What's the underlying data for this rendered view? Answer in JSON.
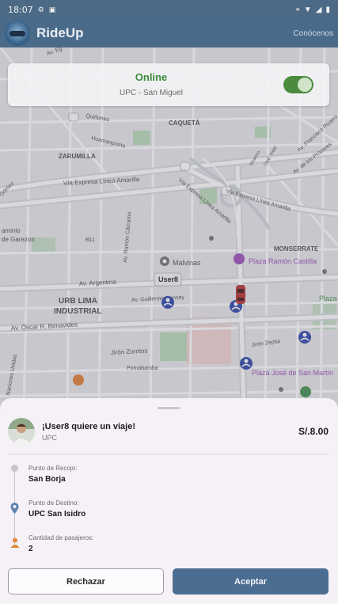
{
  "status_bar": {
    "time": "18:07"
  },
  "app_bar": {
    "title": "RideUp",
    "action": "Conócenos"
  },
  "map": {
    "labels": {
      "caqueta": "CAQUETÁ",
      "zarumilla": "ZARUMILLA",
      "via_expresa_1": "Vía Expresa Línea Amarilla",
      "via_expresa_2": "Vía Expresa Línea Amarilla",
      "via_expresa_3": "Vía Expresa Línea Amarilla",
      "huamanpoma": "Huamanpoma",
      "quilones": "Quiñones",
      "monserrate": "MONSERRATE",
      "plaza_castilla": "Plaza Ramón Castilla",
      "malvinas": "Malvinas",
      "user_tag": "User8",
      "av_argentina": "Av. Argentina",
      "urb_lima_1": "URB LIMA",
      "urb_lima_2": "INDUSTRIAL",
      "av_gullermo": "Av. Guillermo Dansey",
      "av_oscar": "Av. Óscar R. Benavides",
      "jiron_zorritos": "Jirón Zorritos",
      "jiron_zepita": "Jirón Zepita",
      "plaza_san_martin": "Plaza José de San Martín",
      "pomabamba": "Pomabamba",
      "av_ramon": "Av. Ramón Cárcamo",
      "av_francisco": "Av. Francisco Pizarro",
      "de_los_proceres": "Av. de los Próceres",
      "plaza_label": "Plaza",
      "b11": "B11",
      "gamez": "Gómez",
      "naciones": "Naciones Unidas",
      "garezon": "de Garezon",
      "aminio": "aminio",
      "av_eggg": "Av. Eg",
      "vivanco": "Vivanco",
      "gral_vidal": "Gral. Vidal"
    }
  },
  "status_card": {
    "status": "Online",
    "location": "UPC - San Miguel",
    "online": true
  },
  "request": {
    "title": "¡User8 quiere un viaje!",
    "subtitle": "UPC",
    "price": "S/.8.00",
    "pickup_label": "Punto de Recojo:",
    "pickup_value": "San Borja",
    "destination_label": "Punto de Destino:",
    "destination_value": "UPC San Isidro",
    "passengers_label": "Cantidad de pasajeros:",
    "passengers_value": "2"
  },
  "actions": {
    "reject": "Rechazar",
    "accept": "Aceptar"
  },
  "colors": {
    "primary": "#4a6a8a",
    "accept": "#4c6d92",
    "online_green": "#3b8c3b",
    "sheet_bg": "#f6f1f7"
  }
}
